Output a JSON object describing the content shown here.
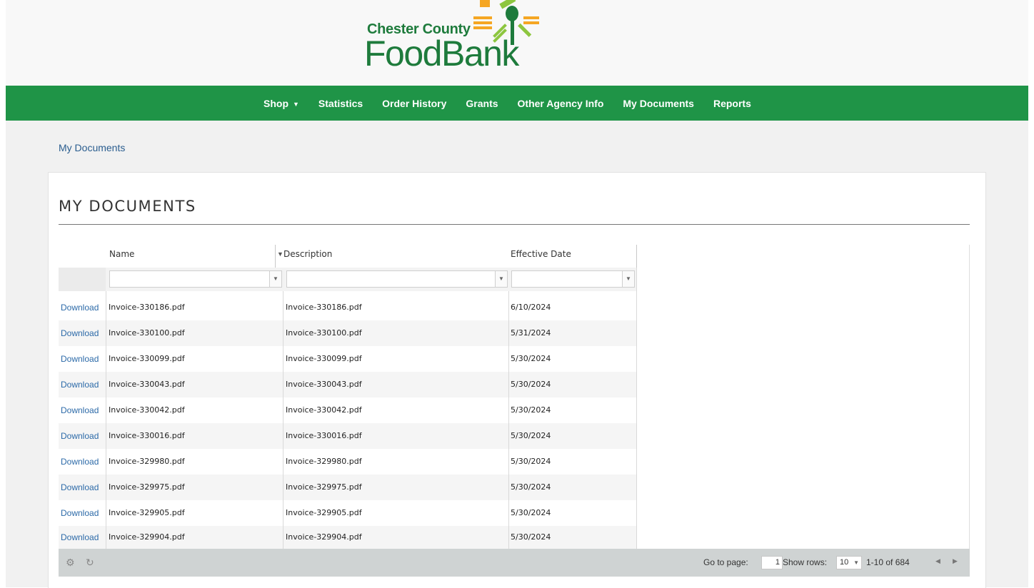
{
  "logo": {
    "line1": "Chester County",
    "line2": "FoodBank",
    "colors": {
      "green": "#1e7b3c",
      "orange": "#f5a623",
      "lime": "#8dc63f"
    }
  },
  "nav": {
    "items": [
      {
        "label": "Shop",
        "has_dropdown": true
      },
      {
        "label": "Statistics"
      },
      {
        "label": "Order History"
      },
      {
        "label": "Grants"
      },
      {
        "label": "Other Agency Info"
      },
      {
        "label": "My Documents"
      },
      {
        "label": "Reports"
      }
    ],
    "background": "#1f9447"
  },
  "breadcrumb": {
    "current": "My Documents"
  },
  "panel": {
    "title": "MY DOCUMENTS"
  },
  "grid": {
    "columns": [
      {
        "label": "Name"
      },
      {
        "label": "Description"
      },
      {
        "label": "Effective Date"
      }
    ],
    "download_label": "Download",
    "rows": [
      {
        "name": "Invoice-330186.pdf",
        "description": "Invoice-330186.pdf",
        "date": "6/10/2024"
      },
      {
        "name": "Invoice-330100.pdf",
        "description": "Invoice-330100.pdf",
        "date": "5/31/2024"
      },
      {
        "name": "Invoice-330099.pdf",
        "description": "Invoice-330099.pdf",
        "date": "5/30/2024"
      },
      {
        "name": "Invoice-330043.pdf",
        "description": "Invoice-330043.pdf",
        "date": "5/30/2024"
      },
      {
        "name": "Invoice-330042.pdf",
        "description": "Invoice-330042.pdf",
        "date": "5/30/2024"
      },
      {
        "name": "Invoice-330016.pdf",
        "description": "Invoice-330016.pdf",
        "date": "5/30/2024"
      },
      {
        "name": "Invoice-329980.pdf",
        "description": "Invoice-329980.pdf",
        "date": "5/30/2024"
      },
      {
        "name": "Invoice-329975.pdf",
        "description": "Invoice-329975.pdf",
        "date": "5/30/2024"
      },
      {
        "name": "Invoice-329905.pdf",
        "description": "Invoice-329905.pdf",
        "date": "5/30/2024"
      },
      {
        "name": "Invoice-329904.pdf",
        "description": "Invoice-329904.pdf",
        "date": "5/30/2024"
      }
    ]
  },
  "pager": {
    "icons": [
      "gear-icon",
      "refresh-icon"
    ],
    "go_to_page_label": "Go to page:",
    "current_page": "1",
    "show_rows_label": "Show rows:",
    "rows_per_page": "10",
    "range_text": "1-10 of 684"
  }
}
